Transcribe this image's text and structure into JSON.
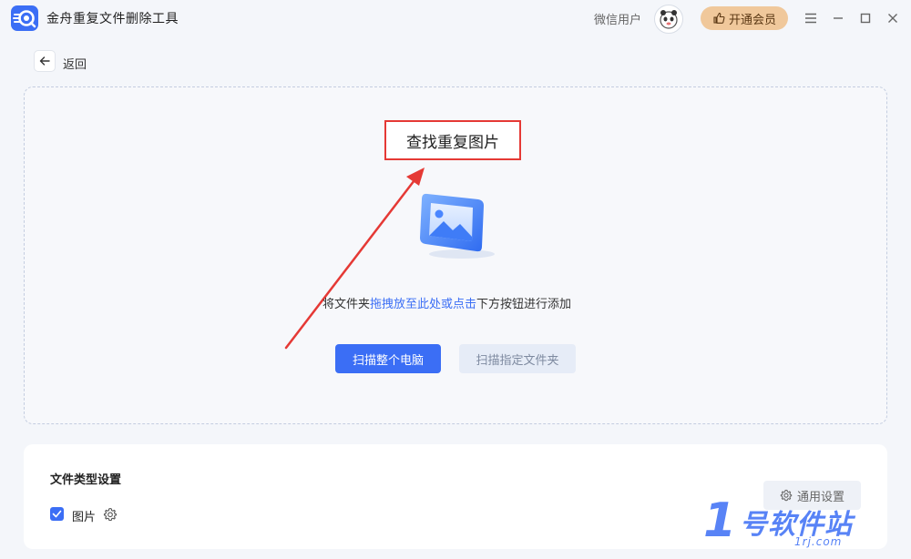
{
  "app": {
    "title": "金舟重复文件删除工具",
    "user_name": "微信用户",
    "vip_label": "开通会员"
  },
  "nav": {
    "back_label": "返回"
  },
  "dropzone": {
    "callout": "查找重复图片",
    "hint_prefix": "将文件夹",
    "hint_link": "拖拽放至此处或点击",
    "hint_suffix": "下方按钮进行添加",
    "scan_all_label": "扫描整个电脑",
    "scan_folder_label": "扫描指定文件夹"
  },
  "file_types": {
    "title": "文件类型设置",
    "items": [
      {
        "label": "图片",
        "checked": true
      }
    ],
    "general_settings_label": "通用设置"
  },
  "watermark": {
    "number": "1",
    "text": "号软件站",
    "sub": "1rj.com"
  },
  "colors": {
    "accent": "#3b6ef5",
    "vip": "#f0c89b",
    "callout_border": "#e53935"
  }
}
